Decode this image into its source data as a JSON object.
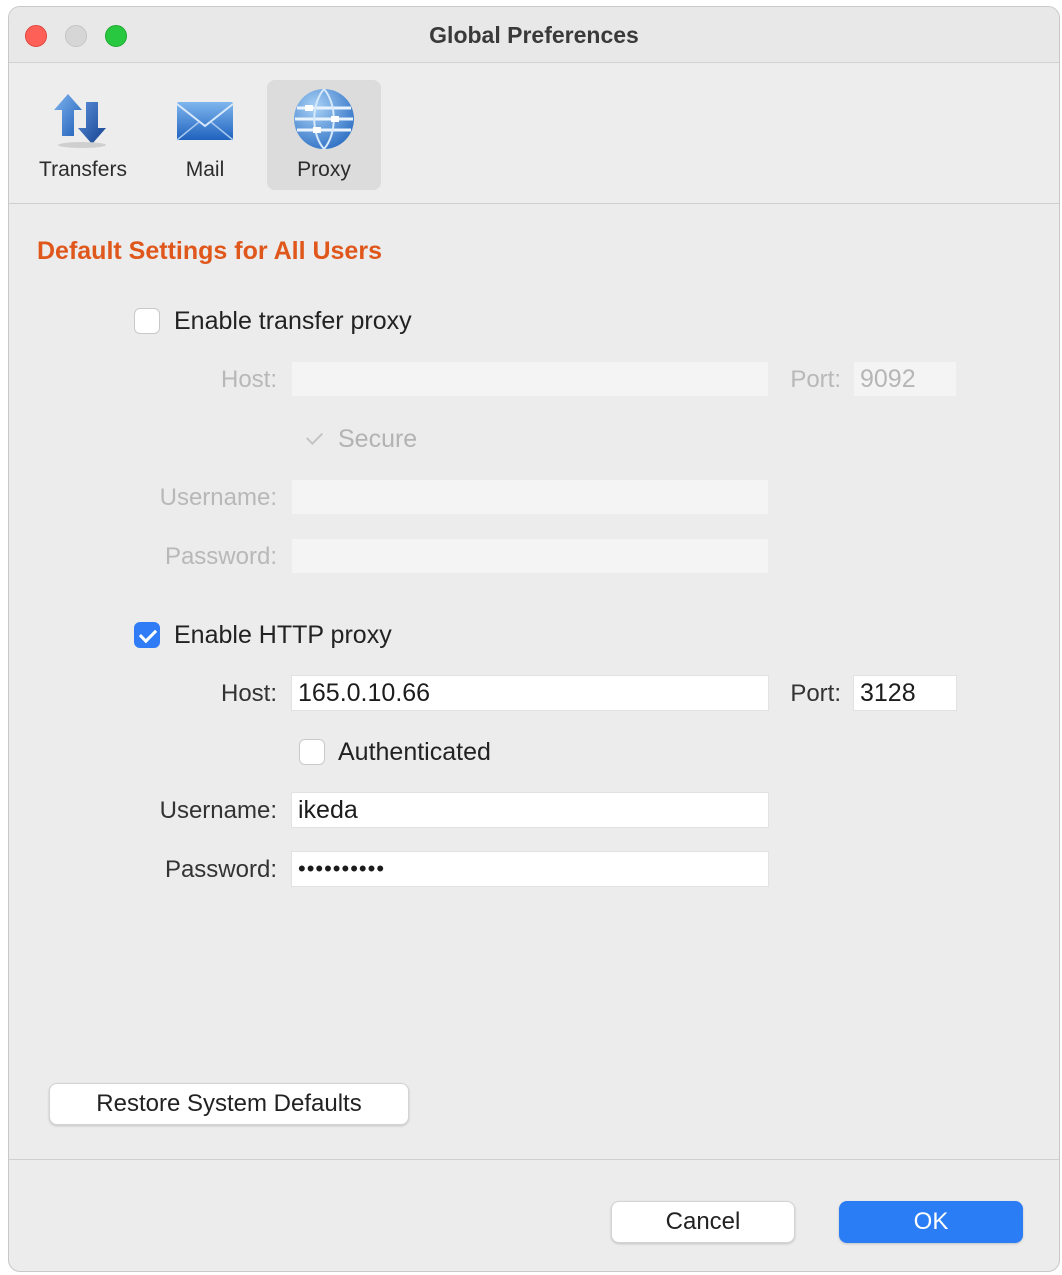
{
  "window": {
    "title": "Global Preferences"
  },
  "toolbar": {
    "items": [
      {
        "label": "Transfers",
        "icon": "transfers-icon",
        "active": false
      },
      {
        "label": "Mail",
        "icon": "mail-icon",
        "active": false
      },
      {
        "label": "Proxy",
        "icon": "proxy-icon",
        "active": true
      }
    ]
  },
  "section": {
    "title": "Default Settings for All Users"
  },
  "transfer_proxy": {
    "enable_label": "Enable transfer proxy",
    "enabled": false,
    "host_label": "Host:",
    "host_value": "",
    "port_label": "Port:",
    "port_value": "9092",
    "secure_label": "Secure",
    "secure_checked": true,
    "username_label": "Username:",
    "username_value": "",
    "password_label": "Password:",
    "password_value": ""
  },
  "http_proxy": {
    "enable_label": "Enable HTTP proxy",
    "enabled": true,
    "host_label": "Host:",
    "host_value": "165.0.10.66",
    "port_label": "Port:",
    "port_value": "3128",
    "authenticated_label": "Authenticated",
    "authenticated_checked": false,
    "username_label": "Username:",
    "username_value": "ikeda",
    "password_label": "Password:",
    "password_value": "••••••••••"
  },
  "buttons": {
    "restore_label": "Restore System Defaults",
    "cancel_label": "Cancel",
    "ok_label": "OK"
  },
  "colors": {
    "accent": "#2b7df6",
    "section_title": "#e0571c",
    "close": "#fe5f57",
    "maximize": "#28c840"
  }
}
